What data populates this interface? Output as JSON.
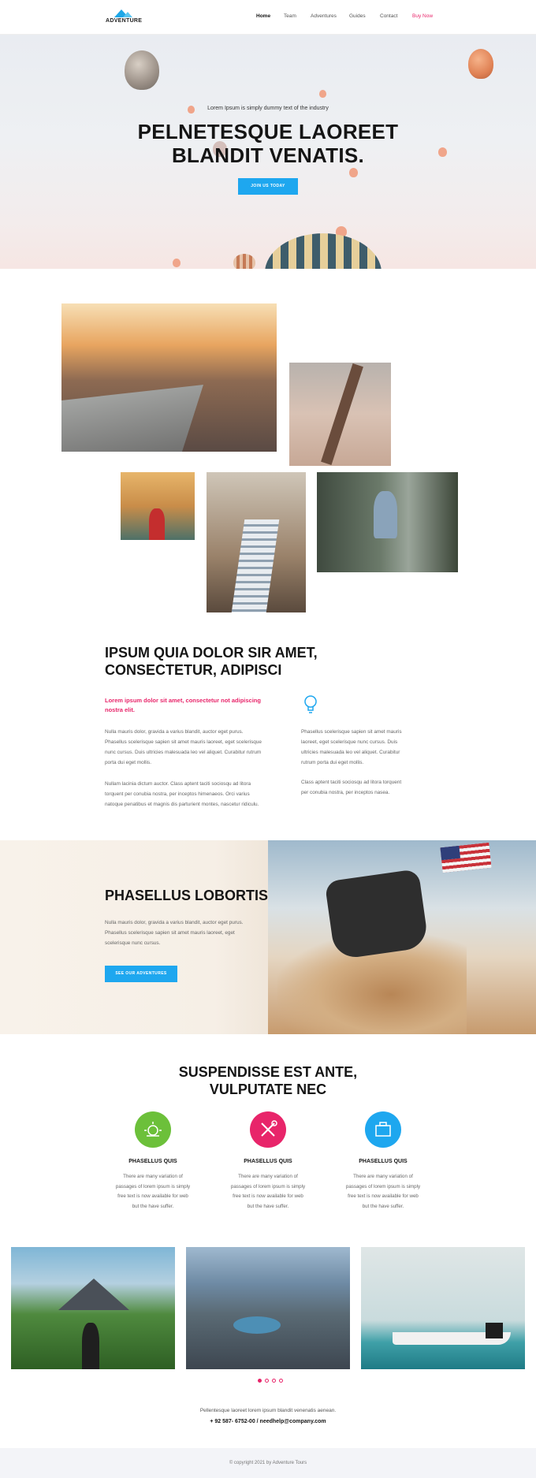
{
  "brand": {
    "name": "ADVENTURE"
  },
  "nav": {
    "items": [
      "Home",
      "Team",
      "Adventures",
      "Guides",
      "Contact"
    ],
    "buy": "Buy Now"
  },
  "hero": {
    "subtitle": "Lorem Ipsum is simply dummy text of the industry",
    "title_line1": "PELNETESQUE LAOREET",
    "title_line2": "BLANDIT VENATIS.",
    "button": "JOIN US TODAY"
  },
  "about": {
    "title_line1": "IPSUM QUIA DOLOR SIR AMET,",
    "title_line2": "CONSECTETUR, ADIPISCI",
    "highlight_line1": "Lorem ipsum dolor sit amet, consectetur not adipiscing",
    "highlight_line2": "nostra elit.",
    "left_p1": [
      "Nulla mauris dolor, gravida a varius blandit, auctor eget purus.",
      "Phasellus scelerisque sapien sit amet mauris laoreet, eget scelerisque",
      "nunc cursus. Duis ultricies malesuada leo vel aliquet. Curabitur rutrum",
      "porta dui eget mollis."
    ],
    "left_p2": [
      "Nullam lacinia dictum auctor. Class aptent taciti sociosqu ad litora",
      "torquent per conubia nostra, per inceptos himenaeos. Orci varius",
      "natoque penatibus et magnis dis parturient montes, nascetur ridiculu."
    ],
    "right_p1": [
      "Phasellus scelerisque sapien sit amet mauris",
      "laoreet, eget scelerisque nunc cursus. Duis",
      "ultricies malesuada leo vel aliquet. Curabitur",
      "rutrum porta dui eget mollis."
    ],
    "right_p2": [
      "Class aptent taciti sociosqu ad litora torquent",
      "per conubia nostra, per inceptos nasea."
    ]
  },
  "promo": {
    "title": "PHASELLUS LOBORTIS",
    "text": [
      "Nulla mauris dolor, gravida a varius blandit, auctor eget purus.",
      "Phasellus scelerisque sapien sit amet mauris laoreet, eget",
      "scelerisque nunc cursus."
    ],
    "button": "SEE OUR ADVENTURES"
  },
  "features": {
    "title_line1": "SUSPENDISSE EST ANTE,",
    "title_line2": "VULPUTATE NEC",
    "items": [
      {
        "title": "PHASELLUS QUIS",
        "color": "#6cc03a",
        "icon": "sun-icon",
        "text": [
          "There are many variation of",
          "passages of lorem ipsum is simply",
          "free text is now available for web",
          "but the have suffer."
        ]
      },
      {
        "title": "PHASELLUS QUIS",
        "color": "#e8256a",
        "icon": "tools-icon",
        "text": [
          "There are many variation of",
          "passages of lorem ipsum is simply",
          "free text is now available for web",
          "but the have suffer."
        ]
      },
      {
        "title": "PHASELLUS QUIS",
        "color": "#1ea7ef",
        "icon": "briefcase-icon",
        "text": [
          "There are many variation of",
          "passages of lorem ipsum is simply",
          "free text is now available for web",
          "but the have suffer."
        ]
      }
    ]
  },
  "contact": {
    "line1": "Pellentesque laoreet lorem ipsum blandit venenatis aenean.",
    "line2": "+ 92 587- 6752-00 / needhelp@company.com"
  },
  "footer": {
    "copyright": "© copyright 2021 by Adventure Tours"
  },
  "colors": {
    "accent": "#1ea7ef",
    "pink": "#e8256a",
    "green": "#6cc03a"
  }
}
